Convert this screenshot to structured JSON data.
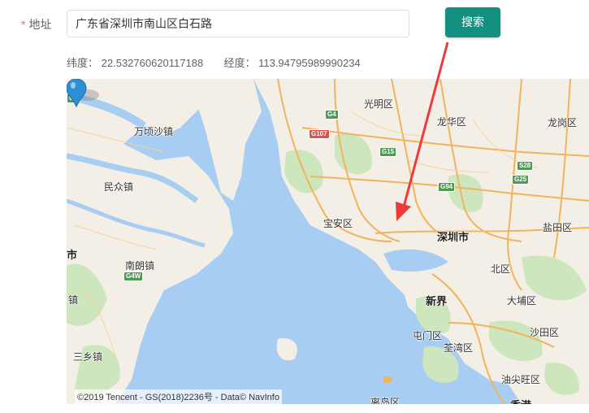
{
  "form": {
    "required_mark": "*",
    "address_label": "地址",
    "address_value": "广东省深圳市南山区白石路",
    "search_label": "搜索"
  },
  "coords": {
    "lat_label": "纬度：",
    "lat_value": "22.532760620117188",
    "lng_label": "经度：",
    "lng_value": "113.94795989990234"
  },
  "map": {
    "places": {
      "guangming": "光明区",
      "longhua": "龙华区",
      "longgang": "龙岗区",
      "wanqingsha": "万顷沙镇",
      "minzhong": "民众镇",
      "baoan": "宝安区",
      "shenzhen": "深圳市",
      "yantian": "盐田区",
      "nanlang": "南朗镇",
      "beiqu": "北区",
      "xinjie": "新界",
      "dapu": "大埔区",
      "tunmen": "屯门区",
      "shatian": "沙田区",
      "quanwan": "荃湾区",
      "youjianwang": "油尖旺区",
      "sanxiang": "三乡镇",
      "zhen": "镇",
      "shi": "市",
      "lidao": "离岛区",
      "xianggang": "香港"
    },
    "shields": {
      "g4": "G4",
      "g107": "G107",
      "g15": "G15",
      "g94": "G94",
      "s28": "S28",
      "g25": "G25",
      "g4w": "G4W",
      "g9": "G9"
    },
    "copyright": "©2019 Tencent - GS(2018)2236号 - Data© NavInfo"
  },
  "colors": {
    "button": "#13907f",
    "required": "#f56c6c",
    "water": "#a7cdf2",
    "land": "#f3efe6",
    "arrow": "#f0393c",
    "marker": "#2c8fd6"
  }
}
